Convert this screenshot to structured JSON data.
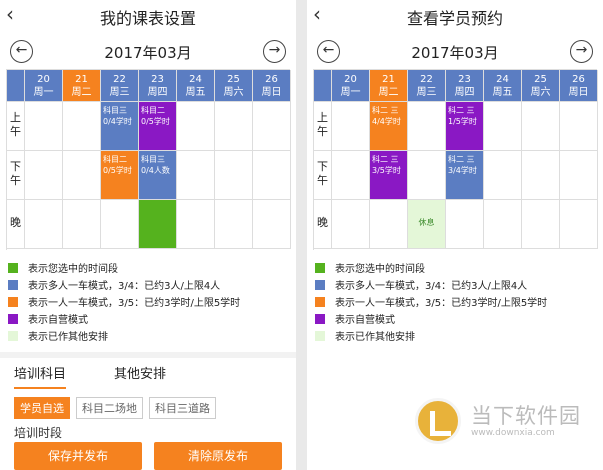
{
  "colors": {
    "header": "#5b7dc2",
    "selected_day": "#f5821f",
    "green": "#55b21e",
    "blue": "#5b7dc2",
    "orange": "#f5821f",
    "purple": "#8a18c4",
    "light_green": "#e4f7d8"
  },
  "left": {
    "back_icon": "chevron-left-icon",
    "title": "我的课表设置",
    "month": "2017年03月",
    "prev_icon": "arrow-left-circle-icon",
    "next_icon": "arrow-right-circle-icon",
    "days": [
      {
        "num": "20",
        "wd": "周一"
      },
      {
        "num": "21",
        "wd": "周二"
      },
      {
        "num": "22",
        "wd": "周三"
      },
      {
        "num": "23",
        "wd": "周四"
      },
      {
        "num": "24",
        "wd": "周五"
      },
      {
        "num": "25",
        "wd": "周六"
      },
      {
        "num": "26",
        "wd": "周日"
      }
    ],
    "selected_day_index": 1,
    "period_am": "上\n午",
    "period_pm": "下\n午",
    "period_eve": "晚",
    "blocks": [
      {
        "row": 0,
        "col": 2,
        "color": "#5b7dc2",
        "text": "科目三\n0/4学时"
      },
      {
        "row": 0,
        "col": 3,
        "color": "#8a18c4",
        "text": "科目二\n0/5学时"
      },
      {
        "row": 1,
        "col": 2,
        "color": "#f5821f",
        "text": "科目二\n0/5学时"
      },
      {
        "row": 1,
        "col": 3,
        "color": "#5b7dc2",
        "text": "科目三\n0/4人数"
      },
      {
        "row": 2,
        "col": 3,
        "color": "#55b21e",
        "text": ""
      }
    ],
    "legend": [
      {
        "color": "#55b21e",
        "text": "表示您选中的时间段"
      },
      {
        "color": "#5b7dc2",
        "text": "表示多人一车模式，3/4：已约3人/上限4人"
      },
      {
        "color": "#f5821f",
        "text": "表示一人一车模式，3/5：已约3学时/上限5学时"
      },
      {
        "color": "#8a18c4",
        "text": "表示自营模式"
      },
      {
        "color": "#e4f7d8",
        "text": "表示已作其他安排"
      }
    ],
    "tabs": [
      "培训科目",
      "其他安排"
    ],
    "chips": [
      "学员自选",
      "科目二场地",
      "科目三道路"
    ],
    "section_label": "培训时段",
    "save_button": "保存并发布",
    "clear_button": "清除原发布"
  },
  "right": {
    "back_icon": "chevron-left-icon",
    "title": "查看学员预约",
    "month": "2017年03月",
    "prev_icon": "arrow-left-circle-icon",
    "next_icon": "arrow-right-circle-icon",
    "days": [
      {
        "num": "20",
        "wd": "周一"
      },
      {
        "num": "21",
        "wd": "周二"
      },
      {
        "num": "22",
        "wd": "周三"
      },
      {
        "num": "23",
        "wd": "周四"
      },
      {
        "num": "24",
        "wd": "周五"
      },
      {
        "num": "25",
        "wd": "周六"
      },
      {
        "num": "26",
        "wd": "周日"
      }
    ],
    "selected_day_index": 1,
    "period_am": "上\n午",
    "period_pm": "下\n午",
    "period_eve": "晚",
    "blocks": [
      {
        "row": 0,
        "col": 1,
        "color": "#f5821f",
        "text": "科二 三\n4/4学时"
      },
      {
        "row": 0,
        "col": 3,
        "color": "#8a18c4",
        "text": "科二 三\n1/5学时"
      },
      {
        "row": 1,
        "col": 1,
        "color": "#8a18c4",
        "text": "科二 三\n3/5学时"
      },
      {
        "row": 1,
        "col": 3,
        "color": "#5b7dc2",
        "text": "科二 三\n3/4学时"
      },
      {
        "row": 2,
        "col": 2,
        "color": "#e4f7d8",
        "text": "休息"
      }
    ],
    "legend": [
      {
        "color": "#55b21e",
        "text": "表示您选中的时间段"
      },
      {
        "color": "#5b7dc2",
        "text": "表示多人一车模式，3/4：已约3人/上限4人"
      },
      {
        "color": "#f5821f",
        "text": "表示一人一车模式，3/5：已约3学时/上限5学时"
      },
      {
        "color": "#8a18c4",
        "text": "表示自营模式"
      },
      {
        "color": "#e4f7d8",
        "text": "表示已作其他安排"
      }
    ]
  },
  "watermark": {
    "logo_icon": "downxia-logo-icon",
    "name": "当下软件园",
    "url": "www.downxia.com"
  }
}
